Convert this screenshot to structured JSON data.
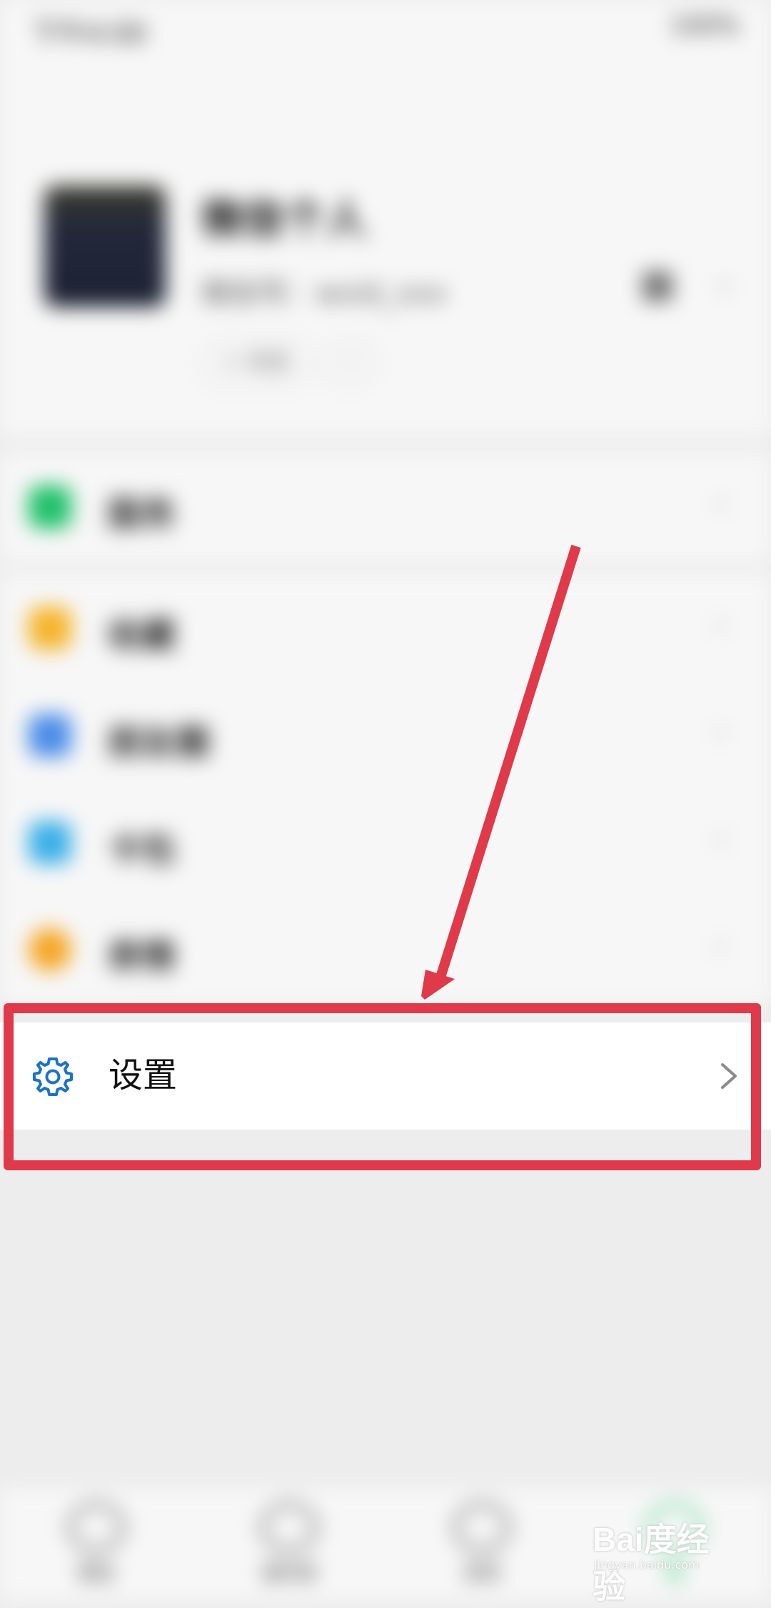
{
  "status_bar": {
    "time": "下午4:00",
    "battery": "100%"
  },
  "profile": {
    "nickname": "微信个人",
    "wechat_id": "微信号：wxid_xxx",
    "status_button": "+ 状态",
    "more_button": "···"
  },
  "menu_items": [
    {
      "label": "服务",
      "icon_color": "#1fc16b"
    },
    {
      "label": "收藏",
      "icon_color": "#f5b52b"
    },
    {
      "label": "朋友圈",
      "icon_color": "#4a8de8"
    },
    {
      "label": "卡包",
      "icon_color": "#3ab0e8"
    },
    {
      "label": "表情",
      "icon_color": "#f5a623"
    }
  ],
  "settings": {
    "label": "设置",
    "icon": "gear-icon",
    "icon_color": "#1a73c9"
  },
  "tabbar": [
    {
      "label": "微信"
    },
    {
      "label": "通讯录"
    },
    {
      "label": "发现"
    },
    {
      "label": "我"
    }
  ],
  "annotation": {
    "color": "#e0394a"
  },
  "watermark": {
    "brand": "Bai度经验",
    "url": "jingyan.baidu.com"
  }
}
